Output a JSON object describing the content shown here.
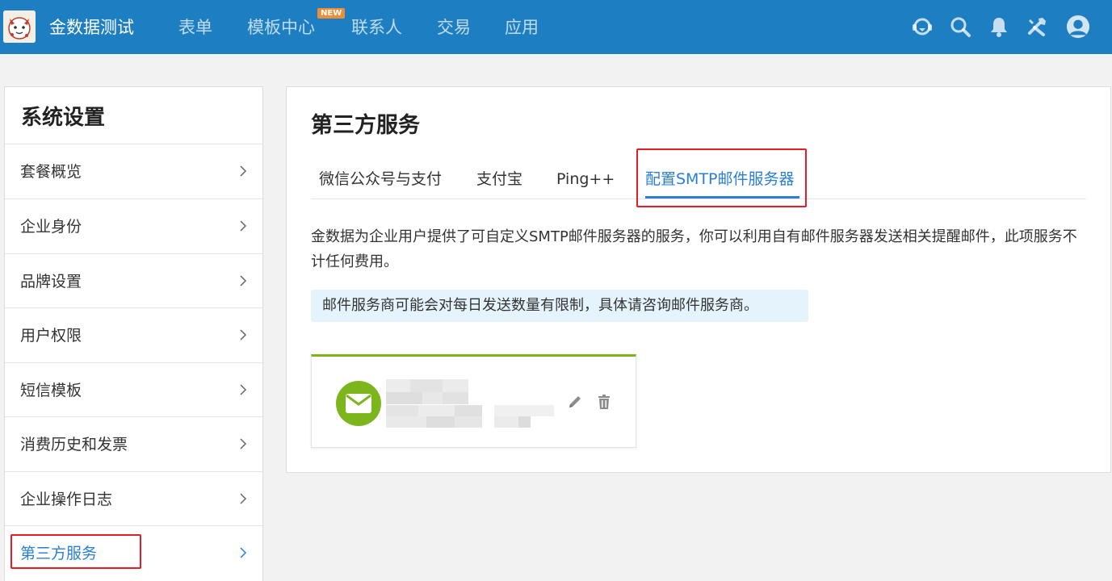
{
  "header": {
    "app_name": "金数据测试",
    "nav": [
      {
        "label": "表单"
      },
      {
        "label": "模板中心",
        "badge": "NEW"
      },
      {
        "label": "联系人"
      },
      {
        "label": "交易"
      },
      {
        "label": "应用"
      }
    ],
    "icons": [
      "support-icon",
      "search-icon",
      "bell-icon",
      "tools-icon",
      "user-avatar-icon"
    ],
    "bg_color": "#1d7fc1"
  },
  "sidebar": {
    "title": "系统设置",
    "items": [
      {
        "label": "套餐概览"
      },
      {
        "label": "企业身份"
      },
      {
        "label": "品牌设置"
      },
      {
        "label": "用户权限"
      },
      {
        "label": "短信模板"
      },
      {
        "label": "消费历史和发票"
      },
      {
        "label": "企业操作日志"
      },
      {
        "label": "第三方服务",
        "active": true
      }
    ]
  },
  "main": {
    "title": "第三方服务",
    "tabs": [
      {
        "label": "微信公众号与支付"
      },
      {
        "label": "支付宝"
      },
      {
        "label": "Ping++"
      },
      {
        "label": "配置SMTP邮件服务器",
        "active": true
      }
    ],
    "description": "金数据为企业用户提供了可自定义SMTP邮件服务器的服务，你可以利用自有邮件服务器发送相关提醒邮件，此项服务不计任何费用。",
    "notice": "邮件服务商可能会对每日发送数量有限制，具体请咨询邮件服务商。",
    "smtp_card": {
      "name": "",
      "email": "",
      "accent_color": "#7db61c"
    }
  },
  "colors": {
    "accent": "#2a7ed3",
    "highlight": "#e51c23",
    "notice_bg": "#e5f3fd"
  }
}
